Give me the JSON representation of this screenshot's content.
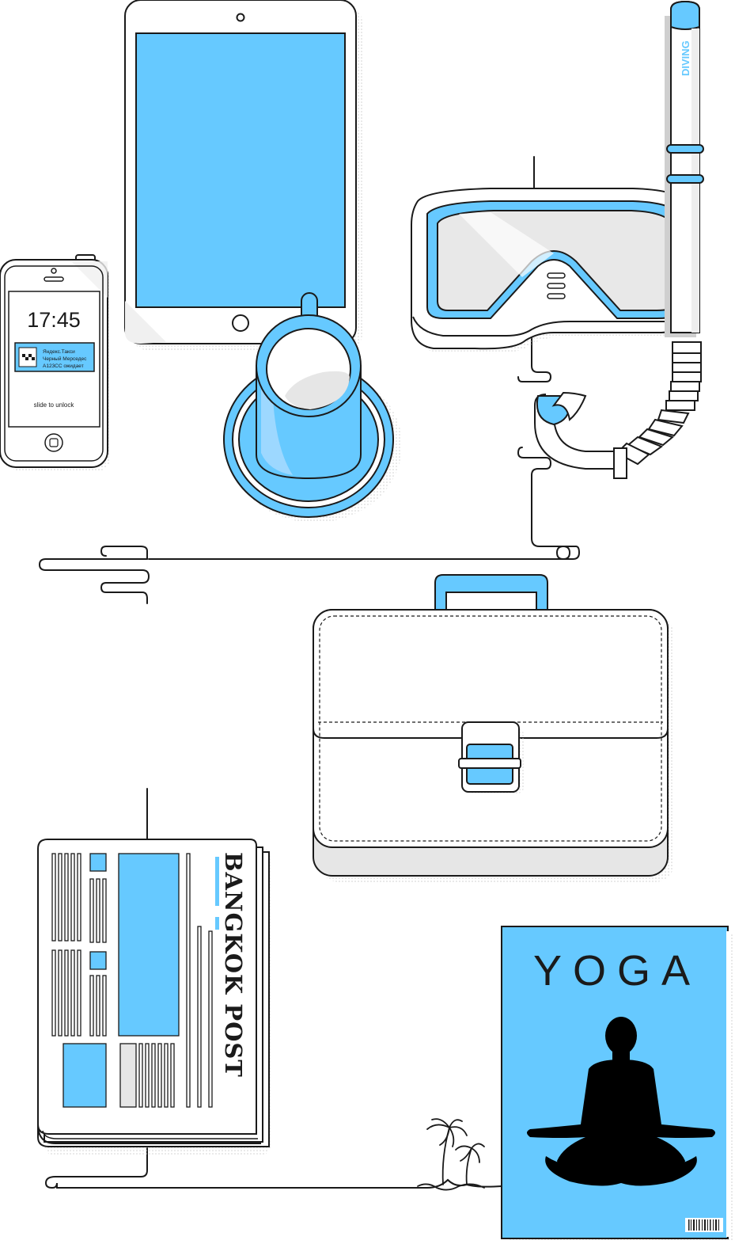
{
  "colors": {
    "accent": "#66c9ff",
    "ink": "#1a1a1a",
    "paper": "#ffffff",
    "shade": "#e6e6e6",
    "shadow": "#cfcfcf"
  },
  "phone": {
    "time": "17:45",
    "notification": {
      "line1": "Яндекс.Такси",
      "line2": "Черный Мерседес",
      "line3": "А123СС ожидает"
    },
    "unlock_text": "slide to unlock"
  },
  "snorkel": {
    "label": "DIVING"
  },
  "newspaper": {
    "masthead": "BANGKOK POST"
  },
  "book": {
    "title": "YOGA"
  },
  "icons": {
    "phone": "smartphone-icon",
    "tablet": "tablet-icon",
    "cup": "coffee-cup-icon",
    "mask": "diving-mask-icon",
    "snorkel": "snorkel-icon",
    "briefcase": "briefcase-icon",
    "newspaper": "newspaper-icon",
    "book": "yoga-book-icon",
    "palm": "palm-tree-icon"
  }
}
